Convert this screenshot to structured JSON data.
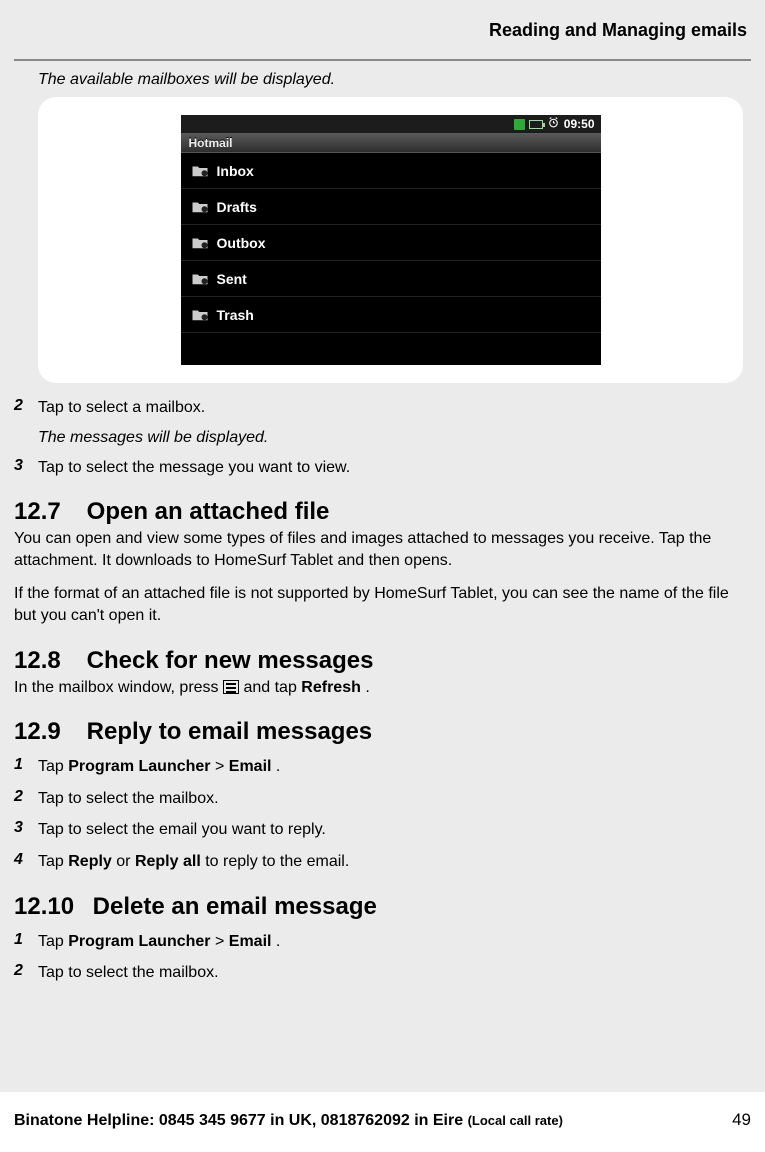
{
  "header": {
    "title": "Reading and Managing emails"
  },
  "intro": "The available mailboxes will be displayed.",
  "device": {
    "statusbar": {
      "time": "09:50"
    },
    "appTitle": "Hotmail",
    "mailboxes": [
      "Inbox",
      "Drafts",
      "Outbox",
      "Sent",
      "Trash"
    ]
  },
  "step2": {
    "num": "2",
    "text": "Tap to select a mailbox."
  },
  "result2": "The messages will be displayed.",
  "step3": {
    "num": "3",
    "text": "Tap to select the message you want to view."
  },
  "s127": {
    "num": "12.7",
    "title": "Open an attached file",
    "p1": "You can open and view some types of files and images attached to messages you receive. Tap the attachment. It downloads to HomeSurf Tablet and then opens.",
    "p2": "If the format of an attached file is not supported by HomeSurf Tablet, you can see the name of the file but you can't open it."
  },
  "s128": {
    "num": "12.8",
    "title": "Check for new messages",
    "pre": "In the mailbox window, press ",
    "post": " and tap ",
    "refresh": "Refresh",
    "end": "."
  },
  "s129": {
    "num": "12.9",
    "title": "Reply to email messages",
    "steps": [
      {
        "num": "1",
        "pre": "Tap ",
        "b1": "Program Launcher",
        "mid": " > ",
        "b2": "Email",
        "post": "."
      },
      {
        "num": "2",
        "text": "Tap to select the mailbox."
      },
      {
        "num": "3",
        "text": "Tap to select the email you want to reply."
      },
      {
        "num": "4",
        "pre": "Tap ",
        "b1": "Reply",
        "mid": " or ",
        "b2": "Reply all",
        "post": " to reply to the email."
      }
    ]
  },
  "s1210": {
    "num": "12.10",
    "title": "Delete an email message",
    "steps": [
      {
        "num": "1",
        "pre": "Tap ",
        "b1": "Program Launcher",
        "mid": " > ",
        "b2": "Email",
        "post": "."
      },
      {
        "num": "2",
        "text": "Tap to select the mailbox."
      }
    ]
  },
  "footer": {
    "helpline1": "Binatone Helpline: 0845 345 9677 in UK, 0818762092 in Eire ",
    "helpline2": "(Local call rate)",
    "page": "49"
  }
}
